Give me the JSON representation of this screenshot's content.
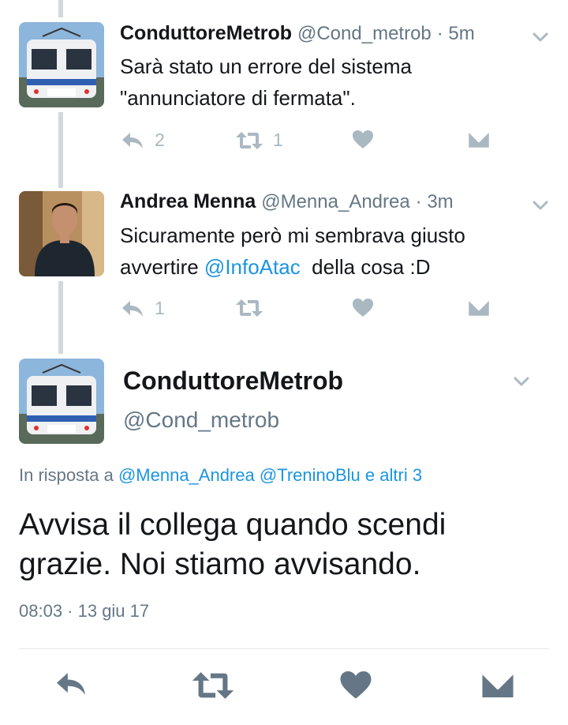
{
  "thread": [
    {
      "name": "ConduttoreMetrob",
      "handle": "@Cond_metrob",
      "time": "· 5m",
      "text_line1": "Sarà stato un errore del sistema",
      "text_line2": "\"annunciatore di fermata\".",
      "reply_count": "2",
      "retweet_count": "1",
      "like_count": "",
      "avatar_icon": "train-avatar"
    },
    {
      "name": "Andrea Menna",
      "handle": "@Menna_Andrea",
      "time": "· 3m",
      "text_line1": "Sicuramente però mi sembrava giusto",
      "text_line2_pre": "avvertire ",
      "text_line2_mention": "@InfoAtac",
      "text_line2_post": "  della cosa :D",
      "reply_count": "1",
      "retweet_count": "",
      "like_count": "",
      "avatar_icon": "person-avatar"
    }
  ],
  "main_tweet": {
    "name": "ConduttoreMetrob",
    "handle": "@Cond_metrob",
    "reply_prefix": "In risposta a ",
    "reply_mention1": "@Menna_Andrea",
    "reply_mention2": "@TreninoBlu",
    "reply_suffix": "e altri 3",
    "text_line1": "Avvisa il collega quando scendi",
    "text_line2": "grazie. Noi stiamo avvisando.",
    "date": "08:03 · 13 giu 17"
  },
  "icons": {
    "reply": "reply-icon",
    "retweet": "retweet-icon",
    "like": "heart-icon",
    "dm": "envelope-icon",
    "menu": "chevron-down-icon"
  },
  "colors": {
    "link": "#1b95e0",
    "muted": "#657786",
    "action": "#aab8c2",
    "action_main": "#657786",
    "thread_line": "#cfd9de"
  }
}
